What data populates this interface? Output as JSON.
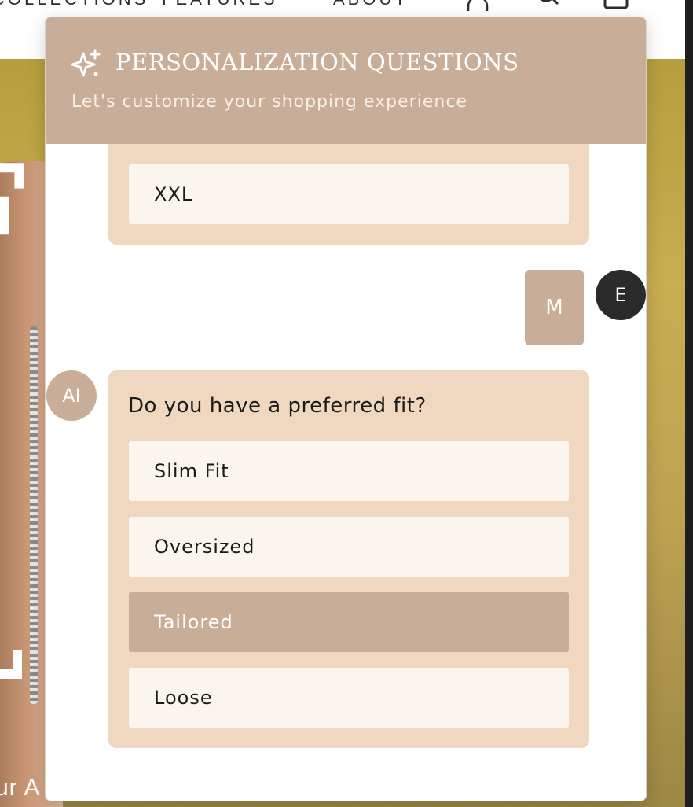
{
  "site_nav": {
    "collections_label": "COLLECTIONS",
    "features_label": "FEATURES",
    "about_label": "ABOUT",
    "account_icon": "user-icon",
    "search_icon": "search-icon",
    "cart_icon": "shopping-bag-icon"
  },
  "hero": {
    "caption_partial": "ur A"
  },
  "panel": {
    "icon": "sparkles-icon",
    "title": "PERSONALIZATION QUESTIONS",
    "subtitle": "Let's customize your shopping experience",
    "accent_color": "#c8ae98",
    "bubble_color": "#f0d8c0"
  },
  "conversation": {
    "previous_options": [
      "",
      "XXL"
    ],
    "user_reply": {
      "avatar_letter": "E",
      "text": "M"
    },
    "ai_question": {
      "avatar_label": "AI",
      "question": "Do you have a preferred fit?",
      "options": [
        "Slim Fit",
        "Oversized",
        "Tailored",
        "Loose"
      ],
      "selected": "Tailored"
    }
  }
}
